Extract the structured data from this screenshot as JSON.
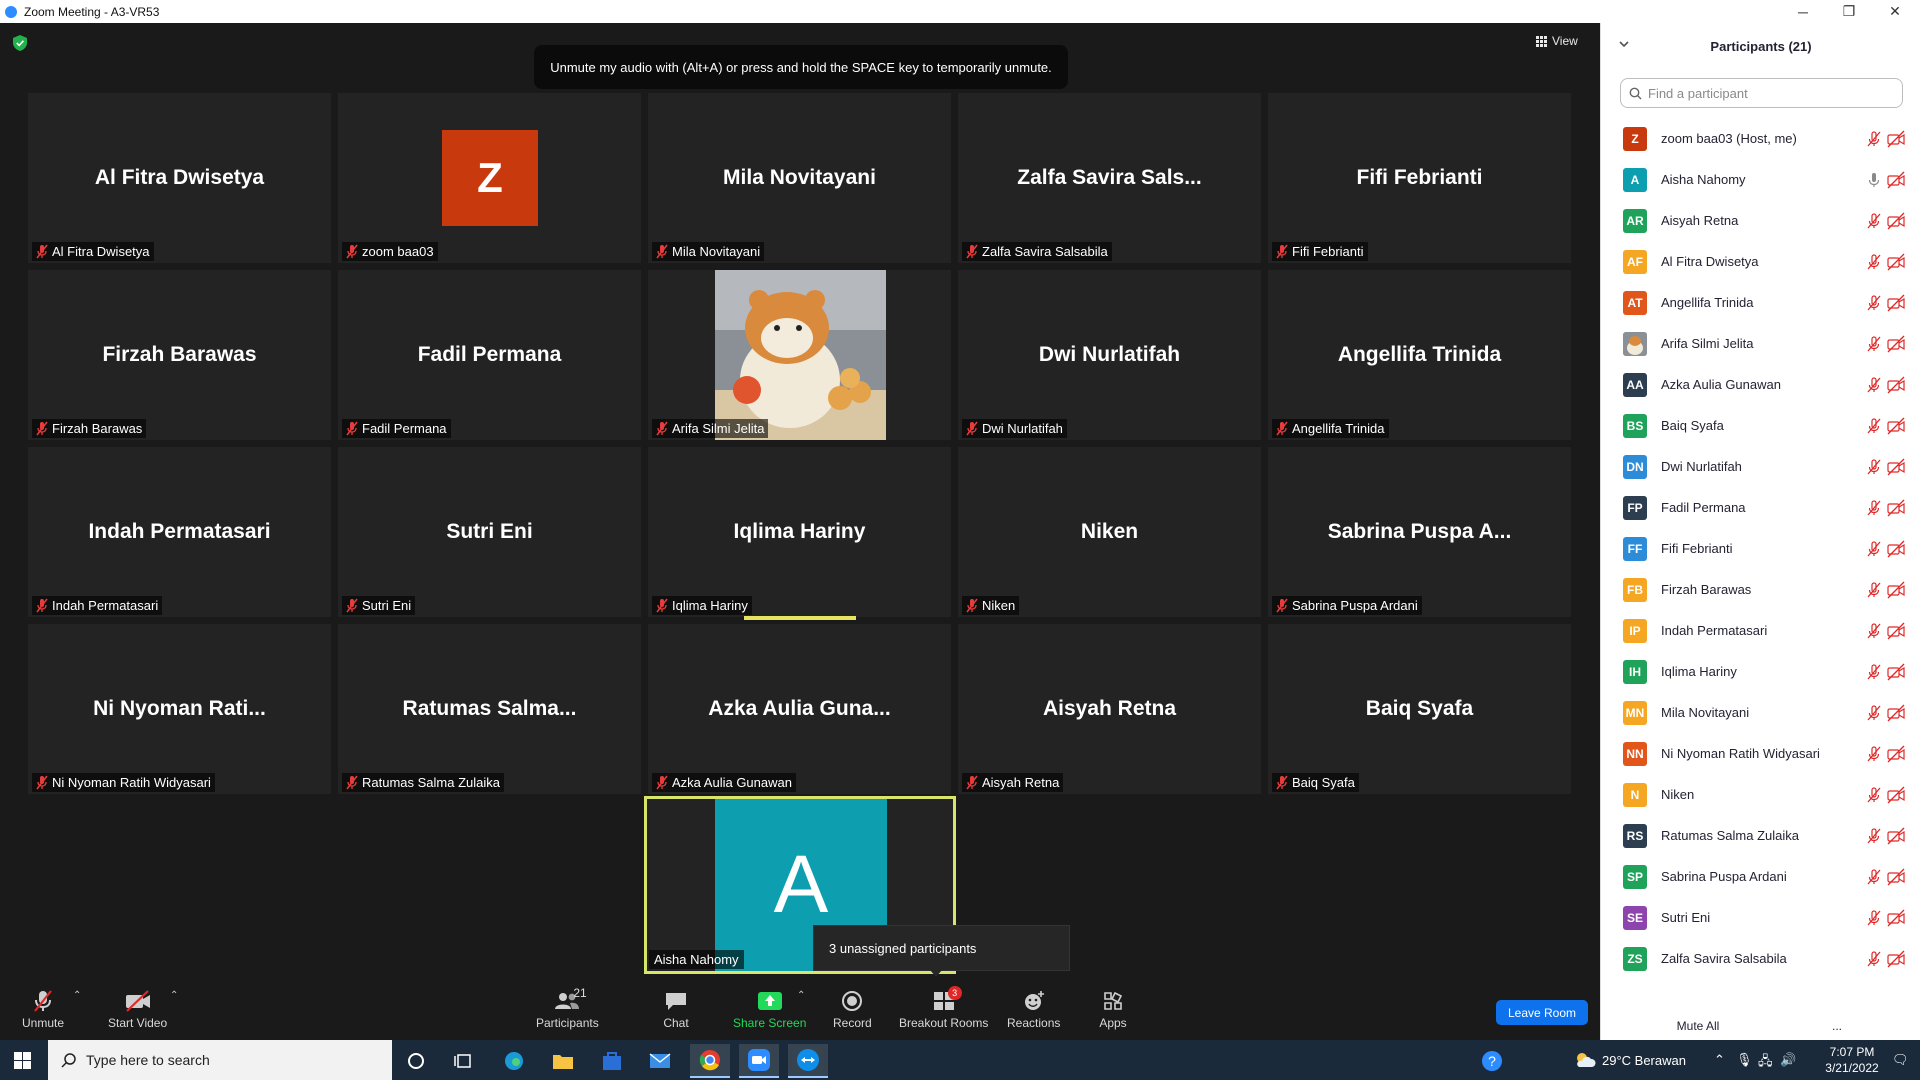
{
  "window": {
    "title": "Zoom Meeting - A3-VR53",
    "minimize": "─",
    "maximize": "❐",
    "close": "✕"
  },
  "meeting": {
    "view_label": "View",
    "toast": "Unmute my audio with (Alt+A) or press and hold the SPACE key to temporarily unmute.",
    "tiles": [
      {
        "display": "Al Fitra Dwisetya",
        "tag": "Al Fitra Dwisetya"
      },
      {
        "display": "Z",
        "tag": "zoom baa03"
      },
      {
        "display": "Mila Novitayani",
        "tag": "Mila Novitayani"
      },
      {
        "display": "Zalfa Savira Sals...",
        "tag": "Zalfa Savira Salsabila"
      },
      {
        "display": "Fifi Febrianti",
        "tag": "Fifi Febrianti"
      },
      {
        "display": "Firzah Barawas",
        "tag": "Firzah Barawas"
      },
      {
        "display": "Fadil Permana",
        "tag": "Fadil Permana"
      },
      {
        "display": "",
        "tag": "Arifa Silmi Jelita"
      },
      {
        "display": "Dwi Nurlatifah",
        "tag": "Dwi Nurlatifah"
      },
      {
        "display": "Angellifa Trinida",
        "tag": "Angellifa Trinida"
      },
      {
        "display": "Indah Permatasari",
        "tag": "Indah Permatasari"
      },
      {
        "display": "Sutri Eni",
        "tag": "Sutri Eni"
      },
      {
        "display": "Iqlima Hariny",
        "tag": "Iqlima Hariny"
      },
      {
        "display": "Niken",
        "tag": "Niken"
      },
      {
        "display": "Sabrina Puspa A...",
        "tag": "Sabrina Puspa Ardani"
      },
      {
        "display": "Ni Nyoman Rati...",
        "tag": "Ni Nyoman Ratih Widyasari"
      },
      {
        "display": "Ratumas Salma...",
        "tag": "Ratumas Salma Zulaika"
      },
      {
        "display": "Azka Aulia Guna...",
        "tag": "Azka Aulia Gunawan"
      },
      {
        "display": "Aisyah Retna",
        "tag": "Aisyah Retna"
      },
      {
        "display": "Baiq Syafa",
        "tag": "Baiq Syafa"
      }
    ],
    "self_tile": {
      "initial": "A",
      "tag": "Aisha Nahomy"
    },
    "tooltip": "3 unassigned participants"
  },
  "toolbar": {
    "unmute": "Unmute",
    "start_video": "Start Video",
    "participants": "Participants",
    "participants_count": "21",
    "chat": "Chat",
    "share_screen": "Share Screen",
    "record": "Record",
    "breakout_rooms": "Breakout Rooms",
    "breakout_badge": "3",
    "reactions": "Reactions",
    "apps": "Apps",
    "leave_room": "Leave Room",
    "share_color": "#23d959"
  },
  "panel": {
    "title": "Participants (21)",
    "search_placeholder": "Find a participant",
    "mute_all": "Mute All",
    "more": "...",
    "participants": [
      {
        "initials": "Z",
        "name": "zoom baa03 (Host, me)",
        "color": "#c9390e",
        "mic": "muted"
      },
      {
        "initials": "A",
        "name": "Aisha Nahomy",
        "color": "#0d9fb0",
        "mic": "on"
      },
      {
        "initials": "AR",
        "name": "Aisyah Retna",
        "color": "#1fa35a",
        "mic": "muted"
      },
      {
        "initials": "AF",
        "name": "Al Fitra Dwisetya",
        "color": "#f5a623",
        "mic": "muted"
      },
      {
        "initials": "AT",
        "name": "Angellifa Trinida",
        "color": "#e0561b",
        "mic": "muted"
      },
      {
        "initials": "",
        "name": "Arifa Silmi Jelita",
        "color": "#a88c6a",
        "mic": "muted",
        "photo": true
      },
      {
        "initials": "AA",
        "name": "Azka Aulia Gunawan",
        "color": "#2c3e50",
        "mic": "muted"
      },
      {
        "initials": "BS",
        "name": "Baiq Syafa",
        "color": "#1fa35a",
        "mic": "muted"
      },
      {
        "initials": "DN",
        "name": "Dwi Nurlatifah",
        "color": "#2d8cd8",
        "mic": "muted"
      },
      {
        "initials": "FP",
        "name": "Fadil Permana",
        "color": "#2c3e50",
        "mic": "muted"
      },
      {
        "initials": "FF",
        "name": "Fifi Febrianti",
        "color": "#2d8cd8",
        "mic": "muted"
      },
      {
        "initials": "FB",
        "name": "Firzah Barawas",
        "color": "#f5a623",
        "mic": "muted"
      },
      {
        "initials": "IP",
        "name": "Indah Permatasari",
        "color": "#f5a623",
        "mic": "muted"
      },
      {
        "initials": "IH",
        "name": "Iqlima Hariny",
        "color": "#1fa35a",
        "mic": "muted"
      },
      {
        "initials": "MN",
        "name": "Mila Novitayani",
        "color": "#f5a623",
        "mic": "muted"
      },
      {
        "initials": "NN",
        "name": "Ni Nyoman Ratih Widyasari",
        "color": "#e0561b",
        "mic": "muted"
      },
      {
        "initials": "N",
        "name": "Niken",
        "color": "#f5a623",
        "mic": "muted"
      },
      {
        "initials": "RS",
        "name": "Ratumas Salma Zulaika",
        "color": "#2c3e50",
        "mic": "muted"
      },
      {
        "initials": "SP",
        "name": "Sabrina Puspa Ardani",
        "color": "#1fa35a",
        "mic": "muted"
      },
      {
        "initials": "SE",
        "name": "Sutri Eni",
        "color": "#8e44ad",
        "mic": "muted"
      },
      {
        "initials": "ZS",
        "name": "Zalfa Savira Salsabila",
        "color": "#1fa35a",
        "mic": "muted"
      }
    ]
  },
  "taskbar": {
    "search_placeholder": "Type here to search",
    "weather": "29°C  Berawan",
    "time": "7:07 PM",
    "date": "3/21/2022"
  }
}
